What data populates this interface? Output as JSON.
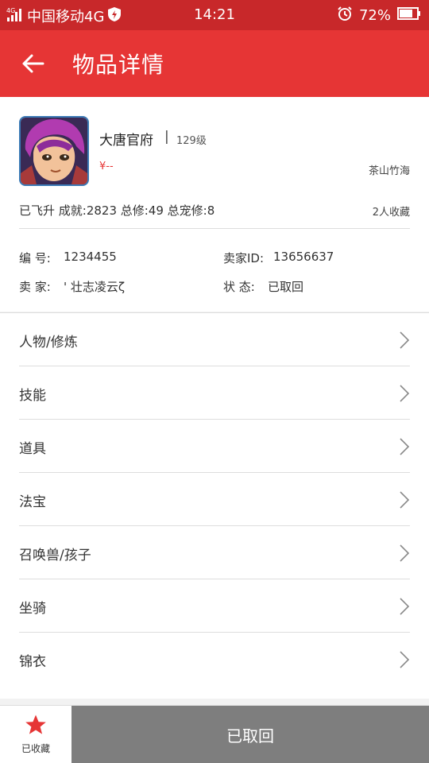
{
  "status_bar": {
    "carrier": "中国移动4G",
    "time": "14:21",
    "battery": "72%"
  },
  "header": {
    "title": "物品详情"
  },
  "item": {
    "name": "大唐官府",
    "separator": "|",
    "level": "129级",
    "price": "¥--",
    "server": "茶山竹海",
    "stats": "已飞升  成就:2823  总修:49  总宠修:8",
    "favorites": "2人收藏",
    "id_label": "编  号:",
    "id_value": "1234455",
    "seller_id_label": "卖家ID:",
    "seller_id_value": "13656637",
    "seller_label": "卖  家:",
    "seller_value": "' 壮志凌云ζ",
    "status_label": "状  态:",
    "status_value": "已取回"
  },
  "menu": [
    {
      "label": "人物/修炼"
    },
    {
      "label": "技能"
    },
    {
      "label": "道具"
    },
    {
      "label": "法宝"
    },
    {
      "label": "召唤兽/孩子"
    },
    {
      "label": "坐骑"
    },
    {
      "label": "锦衣"
    }
  ],
  "footer": {
    "fav_label": "已收藏",
    "action_label": "已取回"
  },
  "colors": {
    "header": "#e63535",
    "statusbar": "#c8282a",
    "button": "#7e7e7e"
  }
}
